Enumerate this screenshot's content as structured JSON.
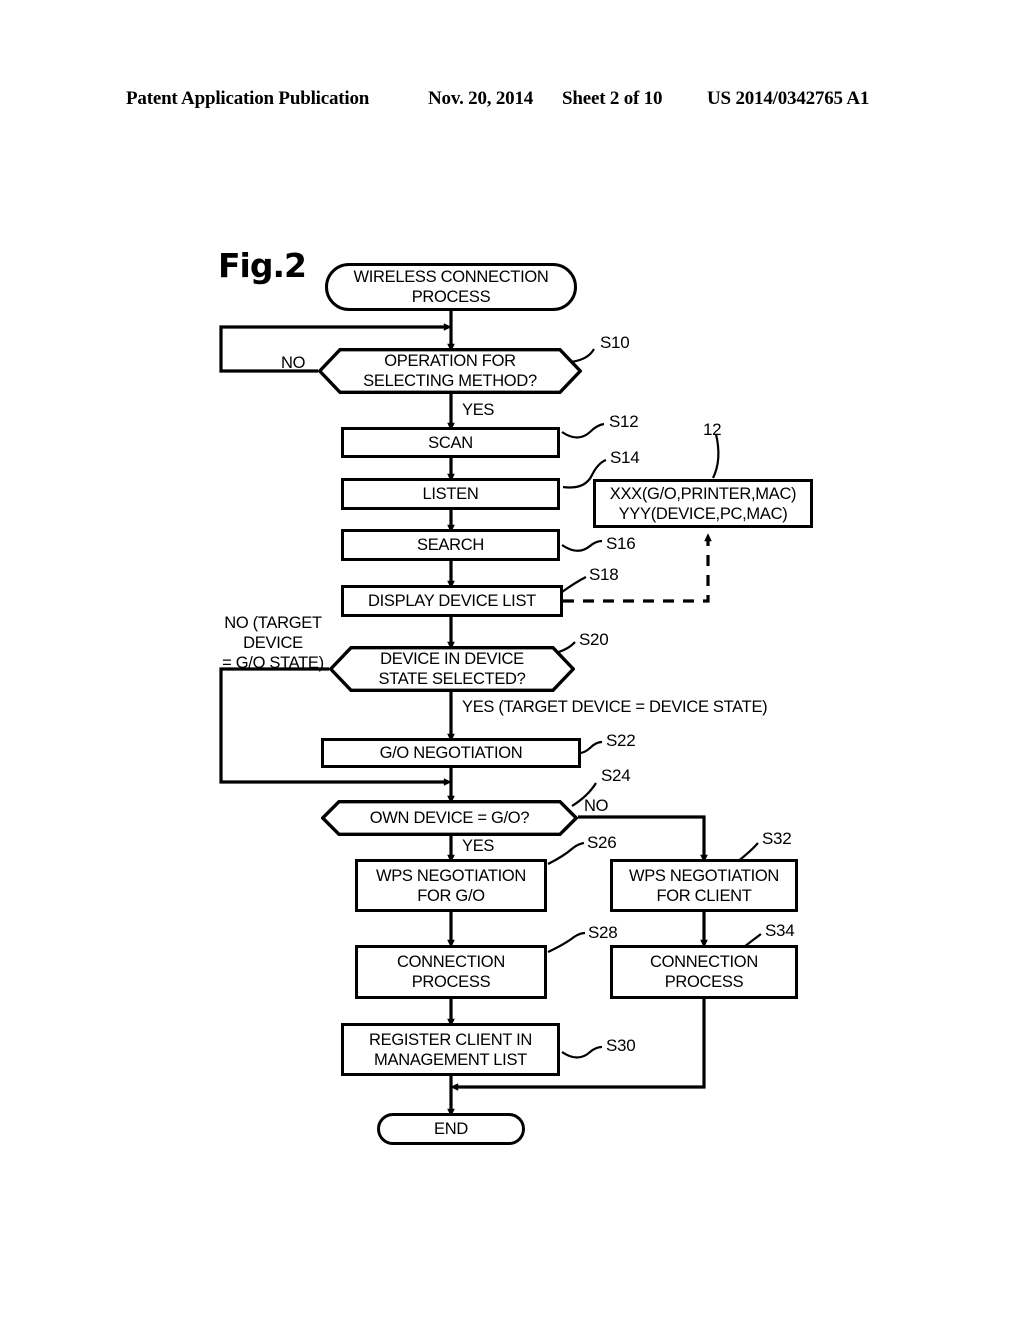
{
  "header": {
    "publication": "Patent Application Publication",
    "date": "Nov. 20, 2014",
    "sheet": "Sheet 2 of 10",
    "number": "US 2014/0342765 A1"
  },
  "figure": {
    "label": "Fig.2",
    "reference_numeral": "12"
  },
  "nodes": {
    "start": "WIRELESS CONNECTION\nPROCESS",
    "s10": "OPERATION FOR\nSELECTING METHOD?",
    "s12": "SCAN",
    "s14": "LISTEN",
    "s16": "SEARCH",
    "s18": "DISPLAY DEVICE LIST",
    "s20": "DEVICE IN DEVICE\nSTATE SELECTED?",
    "s22": "G/O NEGOTIATION",
    "s24": "OWN DEVICE = G/O?",
    "s26": "WPS NEGOTIATION\nFOR G/O",
    "s28": "CONNECTION\nPROCESS",
    "s30": "REGISTER CLIENT IN\nMANAGEMENT LIST",
    "s32": "WPS NEGOTIATION\nFOR CLIENT",
    "s34": "CONNECTION\nPROCESS",
    "end": "END",
    "device_list": "XXX(G/O,PRINTER,MAC)\nYYY(DEVICE,PC,MAC)"
  },
  "step_labels": {
    "s10": "S10",
    "s12": "S12",
    "s14": "S14",
    "s16": "S16",
    "s18": "S18",
    "s20": "S20",
    "s22": "S22",
    "s24": "S24",
    "s26": "S26",
    "s28": "S28",
    "s30": "S30",
    "s32": "S32",
    "s34": "S34"
  },
  "edge_labels": {
    "s10_no": "NO",
    "s10_yes": "YES",
    "s20_no": "NO (TARGET\nDEVICE\n= G/O STATE)",
    "s20_yes": "YES (TARGET DEVICE = DEVICE STATE)",
    "s24_yes": "YES",
    "s24_no": "NO"
  },
  "colors": {
    "stroke": "#000000",
    "background": "#ffffff"
  }
}
